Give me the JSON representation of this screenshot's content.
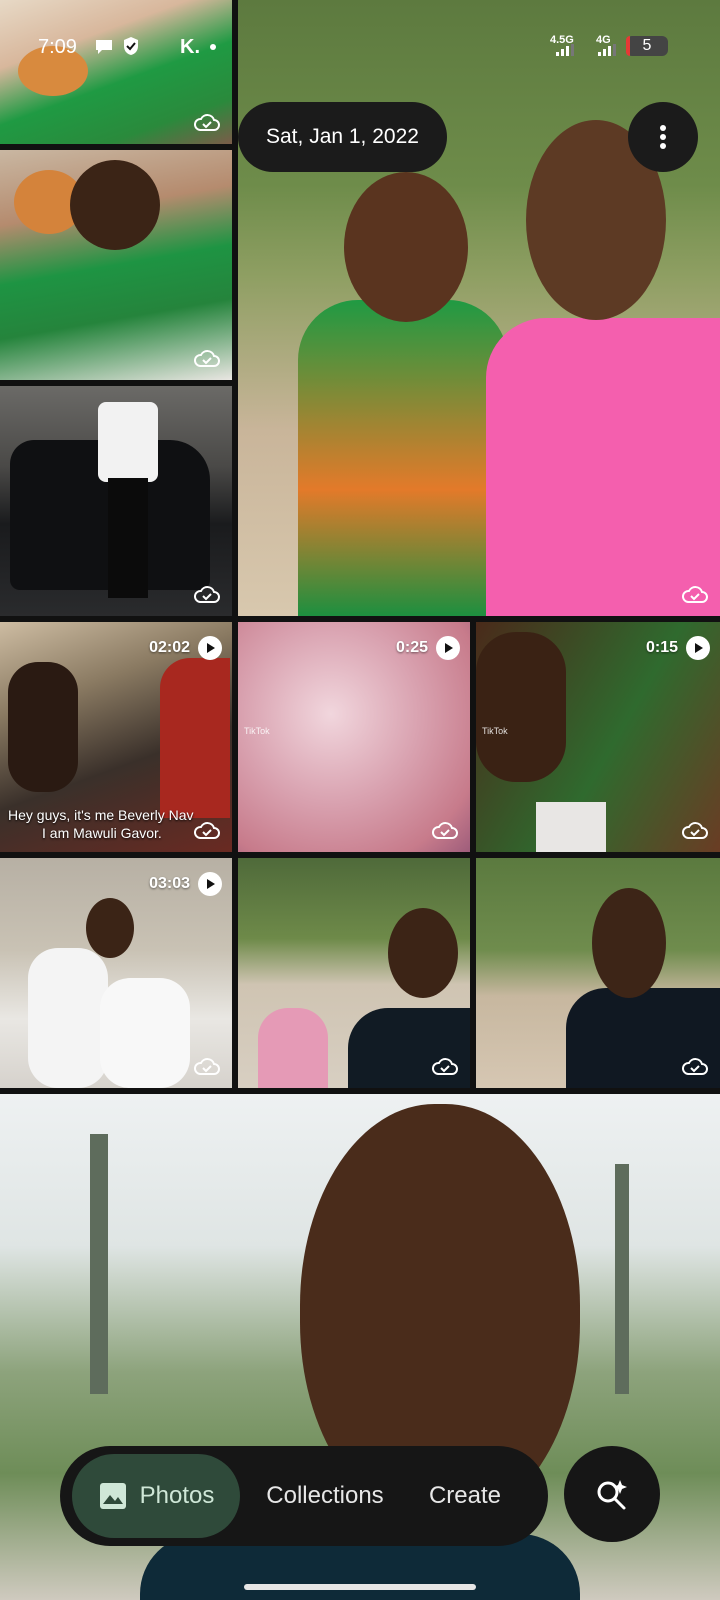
{
  "status_bar": {
    "time": "7:09",
    "network_1": "4.5G",
    "network_2": "4G",
    "battery": "5",
    "icons": [
      "chat-icon",
      "shield-icon",
      "k-app-icon",
      "dot-icon",
      "signal-icon",
      "battery-icon"
    ]
  },
  "header": {
    "date": "Sat, Jan 1, 2022"
  },
  "grid": {
    "tiles": [
      {
        "kind": "photo",
        "sync": "cloud-check-icon"
      },
      {
        "kind": "photo",
        "sync": "cloud-check-icon"
      },
      {
        "kind": "photo",
        "sync": "cloud-check-icon"
      },
      {
        "kind": "photo",
        "sync": "cloud-check-icon"
      },
      {
        "kind": "video",
        "duration": "02:02",
        "caption_line1": "Hey guys, it's me Beverly Nav",
        "caption_line2": "I am Mawuli Gavor."
      },
      {
        "kind": "video",
        "duration": "0:25",
        "watermark": "TikTok"
      },
      {
        "kind": "video",
        "duration": "0:15",
        "watermark": "TikTok"
      },
      {
        "kind": "video",
        "duration": "03:03"
      },
      {
        "kind": "photo",
        "sync": "cloud-check-icon"
      },
      {
        "kind": "photo",
        "sync": "cloud-check-icon"
      }
    ]
  },
  "bottom_nav": {
    "photos": "Photos",
    "collections": "Collections",
    "create": "Create",
    "search_icon": "search-sparkle-icon"
  },
  "colors": {
    "nav_bg": "#161616",
    "active_tab": "#2f4a3a",
    "chip_bg": "#1b1b1b"
  }
}
